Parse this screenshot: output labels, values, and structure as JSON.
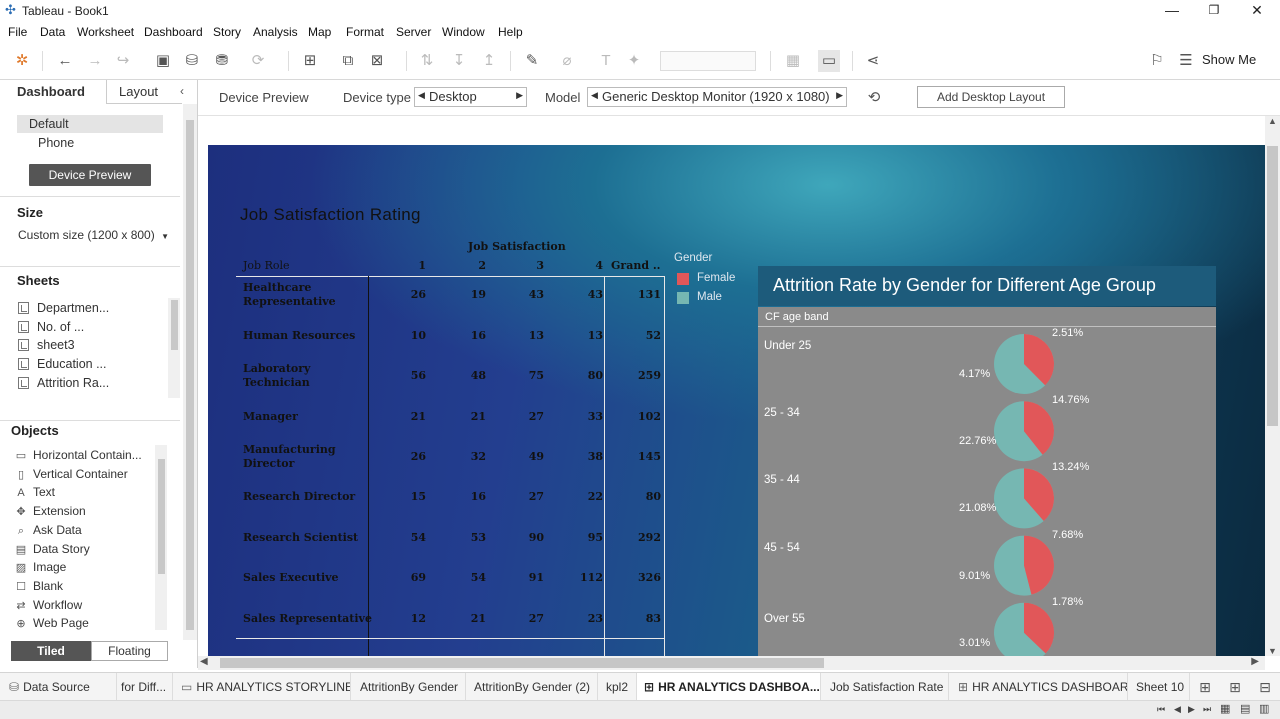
{
  "window": {
    "title": "Tableau - Book1",
    "minimize": "—",
    "restore": "❐",
    "close": "✕"
  },
  "menu": [
    "File",
    "Data",
    "Worksheet",
    "Dashboard",
    "Story",
    "Analysis",
    "Map",
    "Format",
    "Server",
    "Window",
    "Help"
  ],
  "toolbar": {
    "show_me": "Show Me"
  },
  "left_pane": {
    "tab_dashboard": "Dashboard",
    "tab_layout": "Layout",
    "collapse": "‹",
    "device_options": [
      "Default",
      "Phone"
    ],
    "device_preview_button": "Device Preview",
    "size_header": "Size",
    "size_value": "Custom size (1200 x 800)",
    "sheets_header": "Sheets",
    "sheets": [
      "Departmen...",
      "No. of ...",
      "sheet3",
      "Education ...",
      "Attrition Ra..."
    ],
    "objects_header": "Objects",
    "objects": [
      {
        "label": "Horizontal Contain...",
        "icon": "horizontal-container-icon",
        "glyph": "▭"
      },
      {
        "label": "Vertical Container",
        "icon": "vertical-container-icon",
        "glyph": "▯"
      },
      {
        "label": "Text",
        "icon": "text-icon",
        "glyph": "A"
      },
      {
        "label": "Extension",
        "icon": "extension-icon",
        "glyph": "✥"
      },
      {
        "label": "Ask Data",
        "icon": "ask-data-icon",
        "glyph": "⌕"
      },
      {
        "label": "Data Story",
        "icon": "data-story-icon",
        "glyph": "▤"
      },
      {
        "label": "Image",
        "icon": "image-icon",
        "glyph": "▨"
      },
      {
        "label": "Blank",
        "icon": "blank-icon",
        "glyph": "☐"
      },
      {
        "label": "Workflow",
        "icon": "workflow-icon",
        "glyph": "⇄"
      },
      {
        "label": "Web Page",
        "icon": "web-page-icon",
        "glyph": "⊕"
      }
    ],
    "tiled": "Tiled",
    "floating": "Floating"
  },
  "device_bar": {
    "device_preview_label": "Device Preview",
    "device_type_label": "Device type",
    "device_type_value": "Desktop",
    "model_label": "Model",
    "model_value": "Generic Desktop Monitor (1920 x 1080)",
    "add_layout_button": "Add Desktop Layout"
  },
  "dashboard": {
    "title": "Job Satisfaction Rating",
    "crosstab": {
      "column_group_header": "Job Satisfaction",
      "row_header": "Job Role",
      "columns": [
        "1",
        "2",
        "3",
        "4",
        "Grand .."
      ],
      "rows": [
        {
          "role": "Healthcare Representative",
          "values": [
            "26",
            "19",
            "43",
            "43",
            "131"
          ]
        },
        {
          "role": "Human Resources",
          "values": [
            "10",
            "16",
            "13",
            "13",
            "52"
          ]
        },
        {
          "role": "Laboratory Technician",
          "values": [
            "56",
            "48",
            "75",
            "80",
            "259"
          ]
        },
        {
          "role": "Manager",
          "values": [
            "21",
            "21",
            "27",
            "33",
            "102"
          ]
        },
        {
          "role": "Manufacturing Director",
          "values": [
            "26",
            "32",
            "49",
            "38",
            "145"
          ]
        },
        {
          "role": "Research Director",
          "values": [
            "15",
            "16",
            "27",
            "22",
            "80"
          ]
        },
        {
          "role": "Research Scientist",
          "values": [
            "54",
            "53",
            "90",
            "95",
            "292"
          ]
        },
        {
          "role": "Sales Executive",
          "values": [
            "69",
            "54",
            "91",
            "112",
            "326"
          ]
        },
        {
          "role": "Sales Representative",
          "values": [
            "12",
            "21",
            "27",
            "23",
            "83"
          ]
        }
      ]
    },
    "legend": {
      "title": "Gender",
      "items": [
        {
          "label": "Female",
          "color": "#e15759"
        },
        {
          "label": "Male",
          "color": "#76b7b2"
        }
      ]
    }
  },
  "chart_data": {
    "type": "pie",
    "title": "Attrition Rate by Gender for Different Age Group",
    "row_header": "CF age band",
    "groups": [
      {
        "age_band": "Under 25",
        "female": 2.51,
        "male": 4.17,
        "female_label": "2.51%",
        "male_label": "4.17%"
      },
      {
        "age_band": "25 - 34",
        "female": 14.76,
        "male": 22.76,
        "female_label": "14.76%",
        "male_label": "22.76%"
      },
      {
        "age_band": "35 - 44",
        "female": 13.24,
        "male": 21.08,
        "female_label": "13.24%",
        "male_label": "21.08%"
      },
      {
        "age_band": "45 - 54",
        "female": 7.68,
        "male": 9.01,
        "female_label": "7.68%",
        "male_label": "9.01%"
      },
      {
        "age_band": "Over 55",
        "female": 1.78,
        "male": 3.01,
        "female_label": "1.78%",
        "male_label": "3.01%"
      }
    ],
    "colors": {
      "female": "#e15759",
      "male": "#76b7b2"
    }
  },
  "bottom_tabs": [
    {
      "label": "Data Source",
      "icon": "data-source-icon"
    },
    {
      "label": "for Diff...",
      "icon": ""
    },
    {
      "label": "HR ANALYTICS STORYLINE",
      "icon": "story-icon"
    },
    {
      "label": "AttritionBy Gender",
      "icon": ""
    },
    {
      "label": "AttritionBy Gender (2)",
      "icon": ""
    },
    {
      "label": "kpl2",
      "icon": ""
    },
    {
      "label": "HR ANALYTICS DASHBOA...",
      "icon": "dashboard-icon"
    },
    {
      "label": "Job Satisfaction Rate",
      "icon": ""
    },
    {
      "label": "HR ANALYTICS DASHBOAR",
      "icon": "dashboard-icon"
    },
    {
      "label": "Sheet 10",
      "icon": ""
    }
  ]
}
